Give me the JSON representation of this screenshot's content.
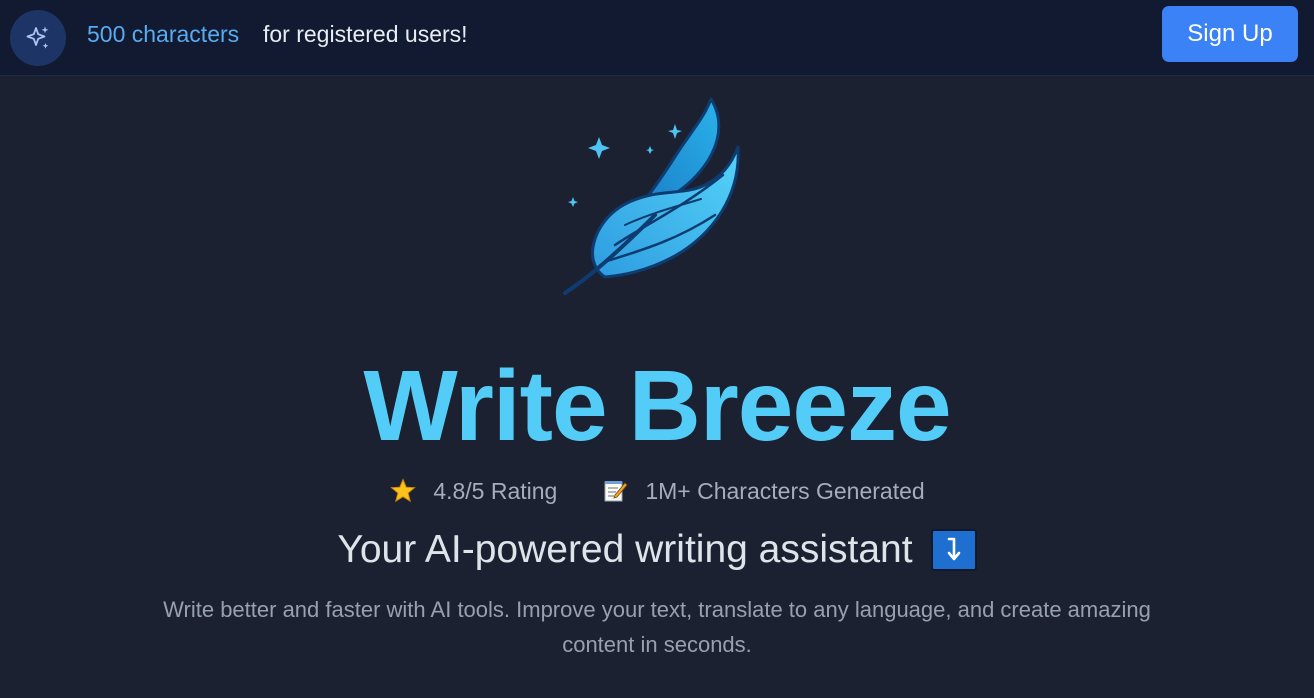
{
  "banner": {
    "icon": "sparkles-icon",
    "highlight": "500 characters",
    "text": "for registered users!",
    "signup_label": "Sign Up"
  },
  "hero": {
    "logo": "feather-logo",
    "title_part1": "Write",
    "title_part2": "Breeze",
    "stats": [
      {
        "icon": "star-icon",
        "label": "4.8/5 Rating"
      },
      {
        "icon": "memo-icon",
        "label": "1M+ Characters Generated"
      }
    ],
    "subtitle": "Your AI-powered writing assistant",
    "subtitle_icon": "down-arrow-icon",
    "description": "Write better and faster with AI tools. Improve your text, translate to any language, and create amazing content in seconds."
  },
  "colors": {
    "background": "#1b2130",
    "banner_background": "#111a30",
    "accent": "#3b82f6",
    "title": "#53cdf7",
    "highlight": "#5aaaf0"
  }
}
